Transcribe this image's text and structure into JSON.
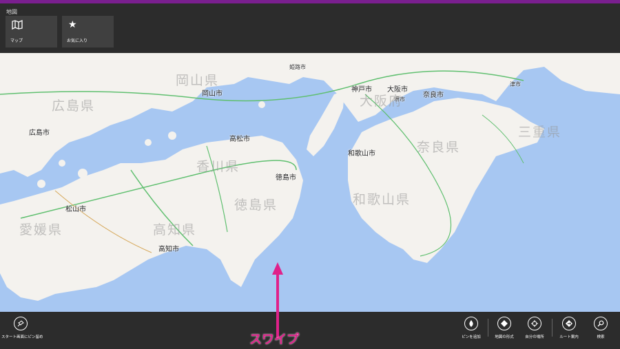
{
  "app": {
    "title": "地図",
    "accent_color": "#7a1f8f"
  },
  "top_bar": {
    "tiles": [
      {
        "label": "マップ",
        "icon": "map-icon"
      },
      {
        "label": "お気に入り",
        "icon": "star-icon"
      }
    ]
  },
  "map": {
    "prefectures": [
      "岡山県",
      "広島県",
      "香川県",
      "徳島県",
      "愛媛県",
      "高知県",
      "大阪府",
      "奈良県",
      "和歌山県",
      "三重県"
    ],
    "cities": [
      "岡山市",
      "広島市",
      "高松市",
      "徳島市",
      "松山市",
      "高知市",
      "神戸市",
      "大阪市",
      "堺市",
      "奈良市",
      "和歌山市",
      "津市",
      "姫路市"
    ],
    "colors": {
      "sea": "#a7c7f2",
      "land": "#f4f2ee",
      "road": "#5fbf6f"
    }
  },
  "bottom_bar": {
    "left_button": {
      "label": "スタート画面にピン留め",
      "icon": "pin-icon"
    },
    "right_buttons": [
      {
        "label": "ピンを追加",
        "icon": "drop-pin-icon"
      },
      {
        "label": "地図の形式",
        "icon": "map-style-icon"
      },
      {
        "label": "自分の場所",
        "icon": "my-location-icon"
      },
      {
        "label": "ルート案内",
        "icon": "directions-icon"
      },
      {
        "label": "検索",
        "icon": "search-icon"
      }
    ]
  },
  "annotation": {
    "label": "スワイプ",
    "color": "#e0218a"
  }
}
